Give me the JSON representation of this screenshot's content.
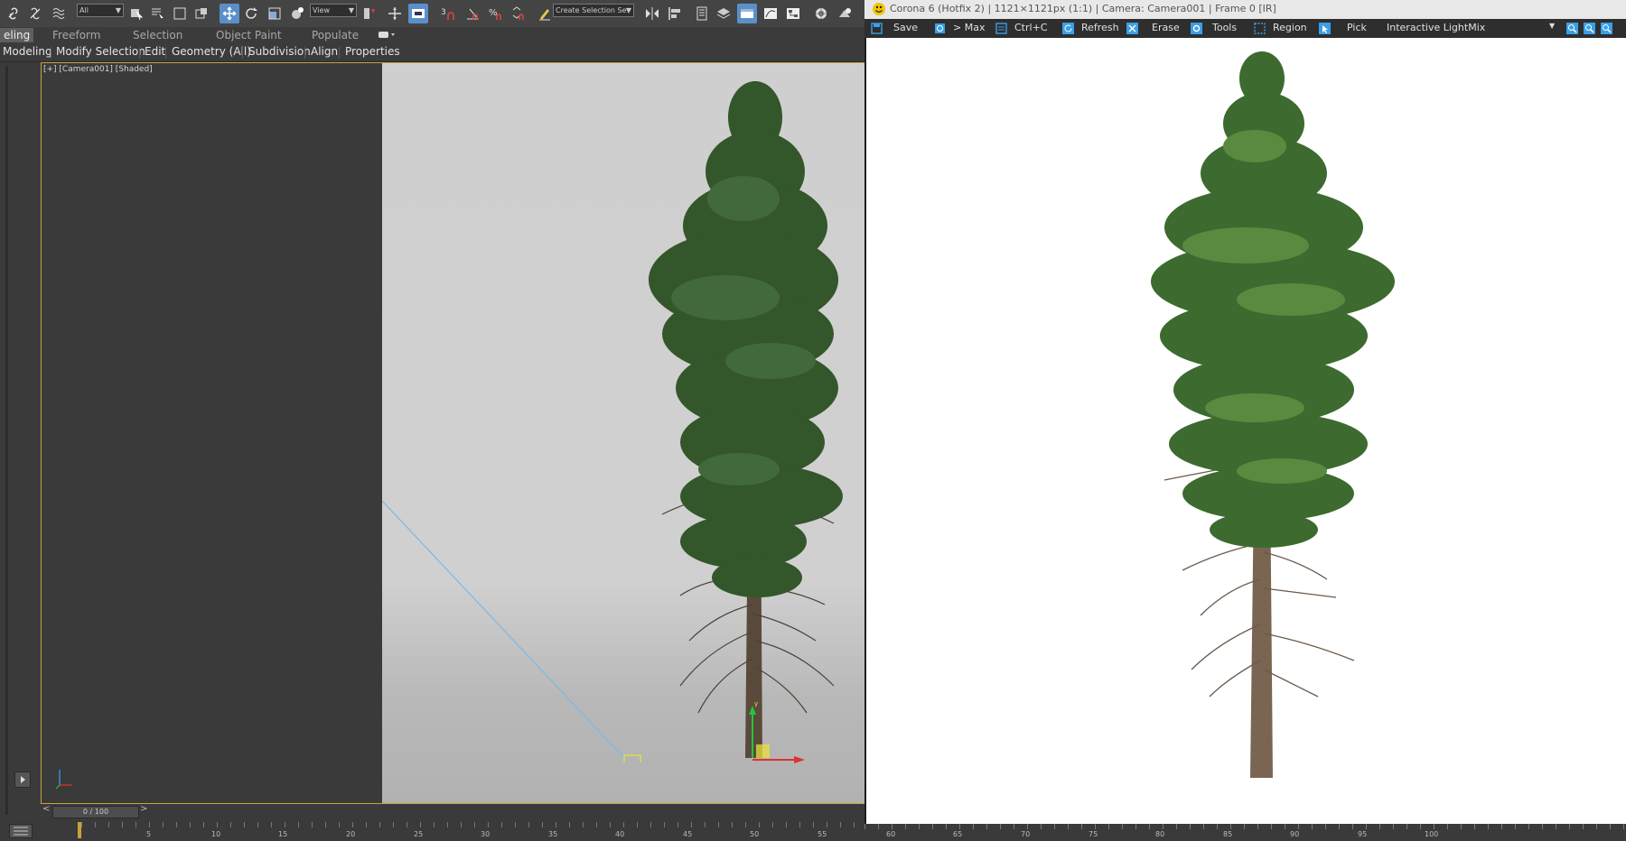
{
  "max": {
    "toolbar": {
      "selection_filter": "All",
      "ref_coord": "View",
      "named_selection": "Create Selection Se",
      "snap_number": "3"
    },
    "ribbon": {
      "tabs": [
        "eling",
        "Freeform",
        "Selection",
        "Object Paint",
        "Populate"
      ],
      "sub": [
        "Modeling",
        "Modify Selection",
        "Edit",
        "Geometry (All)",
        "Subdivision",
        "Align",
        "Properties"
      ]
    },
    "viewport": {
      "label": "[+] [Camera001] [Shaded]",
      "axis_labels": {
        "x": "x",
        "y": "y"
      }
    },
    "timeline": {
      "slider": "0 / 100",
      "ticks": [
        "5",
        "10",
        "15",
        "20",
        "25",
        "30",
        "35",
        "40",
        "45",
        "50",
        "55"
      ],
      "prev_arrow": "<",
      "next_arrow": ">"
    }
  },
  "corona": {
    "title": "Corona 6 (Hotfix 2) | 1121×1121px (1:1) | Camera: Camera001 | Frame 0 [IR]",
    "toolbar": {
      "save": "Save",
      "to_max": "> Max",
      "copy": "Ctrl+C",
      "refresh": "Refresh",
      "erase": "Erase",
      "tools": "Tools",
      "region": "Region",
      "pick": "Pick",
      "lightmix": "Interactive LightMix"
    },
    "ruler_ticks": [
      "60",
      "65",
      "70",
      "75",
      "80",
      "85",
      "90",
      "95",
      "100"
    ]
  },
  "colors": {
    "ui_dark": "#3a3a3a",
    "accent_blue": "#5a8fc9",
    "viewport_border": "#c9a23a",
    "corona_icon": "#3aa0e6"
  }
}
